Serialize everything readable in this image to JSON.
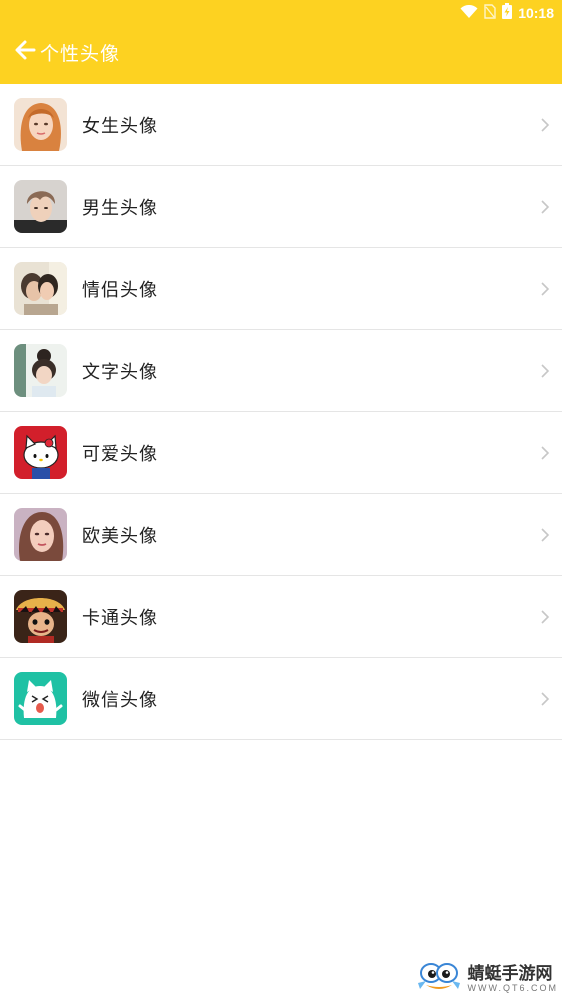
{
  "status_bar": {
    "time": "10:18",
    "icons": [
      "wifi-icon",
      "no-sim-icon",
      "battery-charging-icon"
    ]
  },
  "header": {
    "back_icon": "arrow-left-icon",
    "title": "个性头像",
    "background": "#fdd221"
  },
  "categories": [
    {
      "label": "女生头像",
      "avatar": "girl-portrait"
    },
    {
      "label": "男生头像",
      "avatar": "boy-portrait"
    },
    {
      "label": "情侣头像",
      "avatar": "couple-photo"
    },
    {
      "label": "文字头像",
      "avatar": "text-style-photo"
    },
    {
      "label": "可爱头像",
      "avatar": "hello-kitty"
    },
    {
      "label": "欧美头像",
      "avatar": "western-portrait"
    },
    {
      "label": "卡通头像",
      "avatar": "anime-character"
    },
    {
      "label": "微信头像",
      "avatar": "cartoon-cat"
    }
  ],
  "watermark": {
    "name": "蜻蜓手游网",
    "url": "WWW.QT6.COM"
  }
}
